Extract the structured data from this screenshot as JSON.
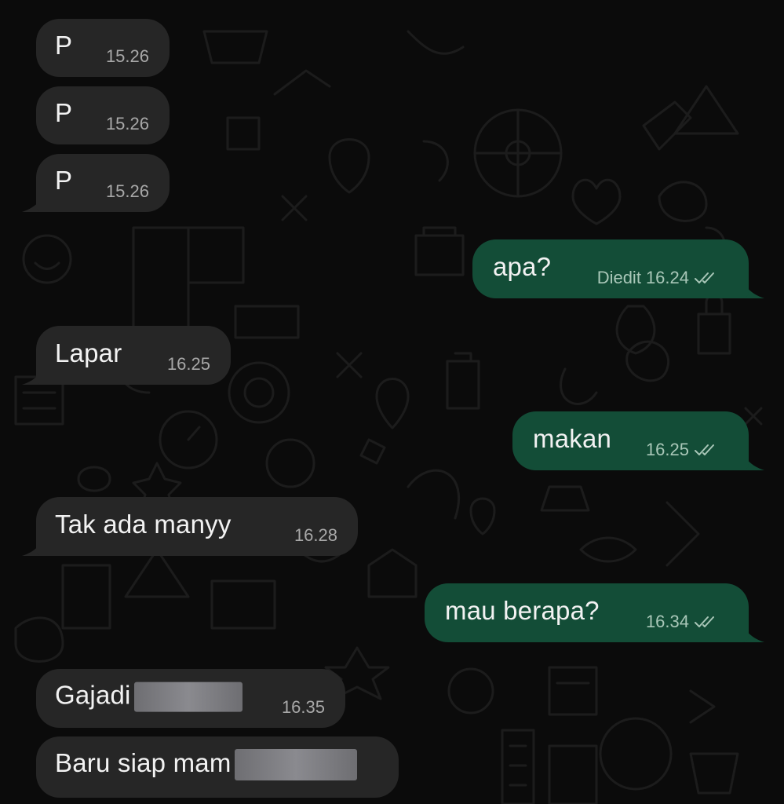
{
  "chat": {
    "messages": [
      {
        "text": "P",
        "time": "15.26",
        "direction": "incoming"
      },
      {
        "text": "P",
        "time": "15.26",
        "direction": "incoming"
      },
      {
        "text": "P",
        "time": "15.26",
        "direction": "incoming"
      },
      {
        "text": "apa?",
        "edited": "Diedit",
        "time": "16.24",
        "direction": "outgoing",
        "status": "read-double-check"
      },
      {
        "text": "Lapar",
        "time": "16.25",
        "direction": "incoming"
      },
      {
        "text": "makan",
        "time": "16.25",
        "direction": "outgoing",
        "status": "read-double-check"
      },
      {
        "text": "Tak ada manyy",
        "time": "16.28",
        "direction": "incoming"
      },
      {
        "text": "mau berapa?",
        "time": "16.34",
        "direction": "outgoing",
        "status": "read-double-check"
      },
      {
        "text": "Gajadi",
        "time": "16.35",
        "direction": "incoming",
        "redacted": true
      },
      {
        "text": "Baru siap mam",
        "direction": "incoming",
        "redacted": true
      }
    ]
  },
  "colors": {
    "background": "#0b0b0b",
    "incoming_bubble": "#262626",
    "outgoing_bubble": "#134d37",
    "doodle": "#222222"
  },
  "icons": {
    "read_receipt": "double-check-icon",
    "wallpaper": "doodle-pattern"
  }
}
